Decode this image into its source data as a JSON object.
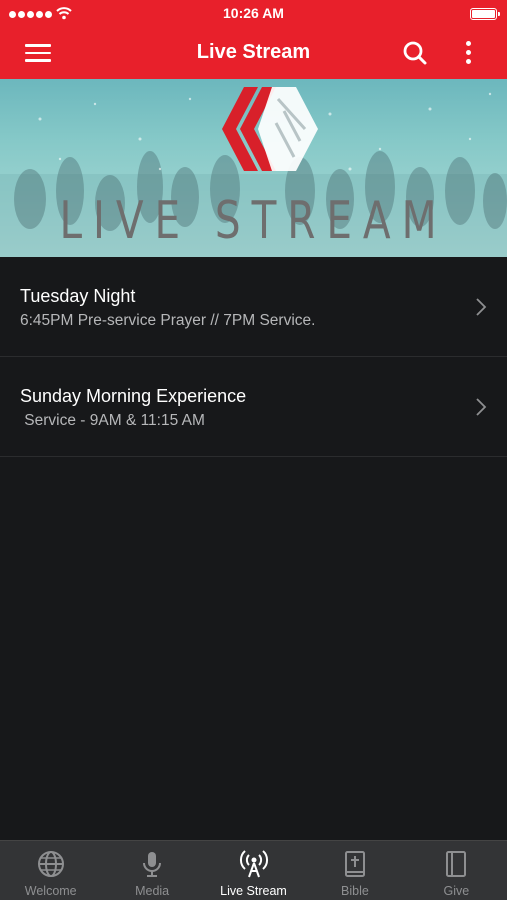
{
  "status_bar": {
    "time": "10:26 AM"
  },
  "app_bar": {
    "title": "Live Stream",
    "menu_icon": "hamburger-menu-icon",
    "search_icon": "search-icon",
    "more_icon": "more-vertical-icon"
  },
  "banner": {
    "text": "LIVE STREAM",
    "logo": "chevron-logo"
  },
  "items": [
    {
      "title": "Tuesday Night",
      "subtitle": "6:45PM Pre-service Prayer // 7PM Service."
    },
    {
      "title": "Sunday Morning Experience",
      "subtitle": " Service - 9AM & 11:15 AM"
    }
  ],
  "tabs": [
    {
      "label": "Welcome",
      "icon": "globe-icon",
      "active": false
    },
    {
      "label": "Media",
      "icon": "microphone-icon",
      "active": false
    },
    {
      "label": "Live Stream",
      "icon": "broadcast-icon",
      "active": true
    },
    {
      "label": "Bible",
      "icon": "bible-icon",
      "active": false
    },
    {
      "label": "Give",
      "icon": "book-icon",
      "active": false
    }
  ],
  "colors": {
    "accent": "#e8202b",
    "background": "#17181a",
    "tab_bar": "#333436"
  }
}
